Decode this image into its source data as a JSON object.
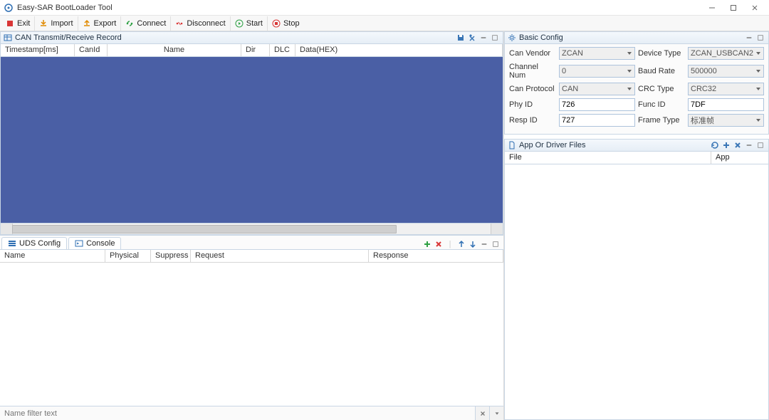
{
  "app": {
    "title": "Easy-SAR BootLoader Tool"
  },
  "toolbar": {
    "exit": "Exit",
    "import": "Import",
    "export": "Export",
    "connect": "Connect",
    "disconnect": "Disconnect",
    "start": "Start",
    "stop": "Stop"
  },
  "panels": {
    "can_record": {
      "title": "CAN Transmit/Receive Record",
      "columns": {
        "timestamp": "Timestamp[ms]",
        "canid": "CanId",
        "name": "Name",
        "dir": "Dir",
        "dlc": "DLC",
        "data": "Data(HEX)"
      }
    },
    "basic_config": {
      "title": "Basic Config",
      "labels": {
        "can_vendor": "Can Vendor",
        "device_type": "Device Type",
        "channel_num": "Channel Num",
        "baud_rate": "Baud Rate",
        "can_protocol": "Can Protocol",
        "crc_type": "CRC Type",
        "phy_id": "Phy ID",
        "func_id": "Func ID",
        "resp_id": "Resp ID",
        "frame_type": "Frame Type"
      },
      "values": {
        "can_vendor": "ZCAN",
        "device_type": "ZCAN_USBCAN2",
        "channel_num": "0",
        "baud_rate": "500000",
        "can_protocol": "CAN",
        "crc_type": "CRC32",
        "phy_id": "726",
        "func_id": "7DF",
        "resp_id": "727",
        "frame_type": "标准帧"
      }
    },
    "app_files": {
      "title": "App Or Driver Files",
      "columns": {
        "file": "File",
        "app": "App"
      }
    },
    "uds": {
      "tab_uds": "UDS Config",
      "tab_console": "Console",
      "columns": {
        "name": "Name",
        "physical": "Physical",
        "suppress": "Suppress",
        "request": "Request",
        "response": "Response"
      },
      "filter_placeholder": "Name filter text"
    }
  }
}
